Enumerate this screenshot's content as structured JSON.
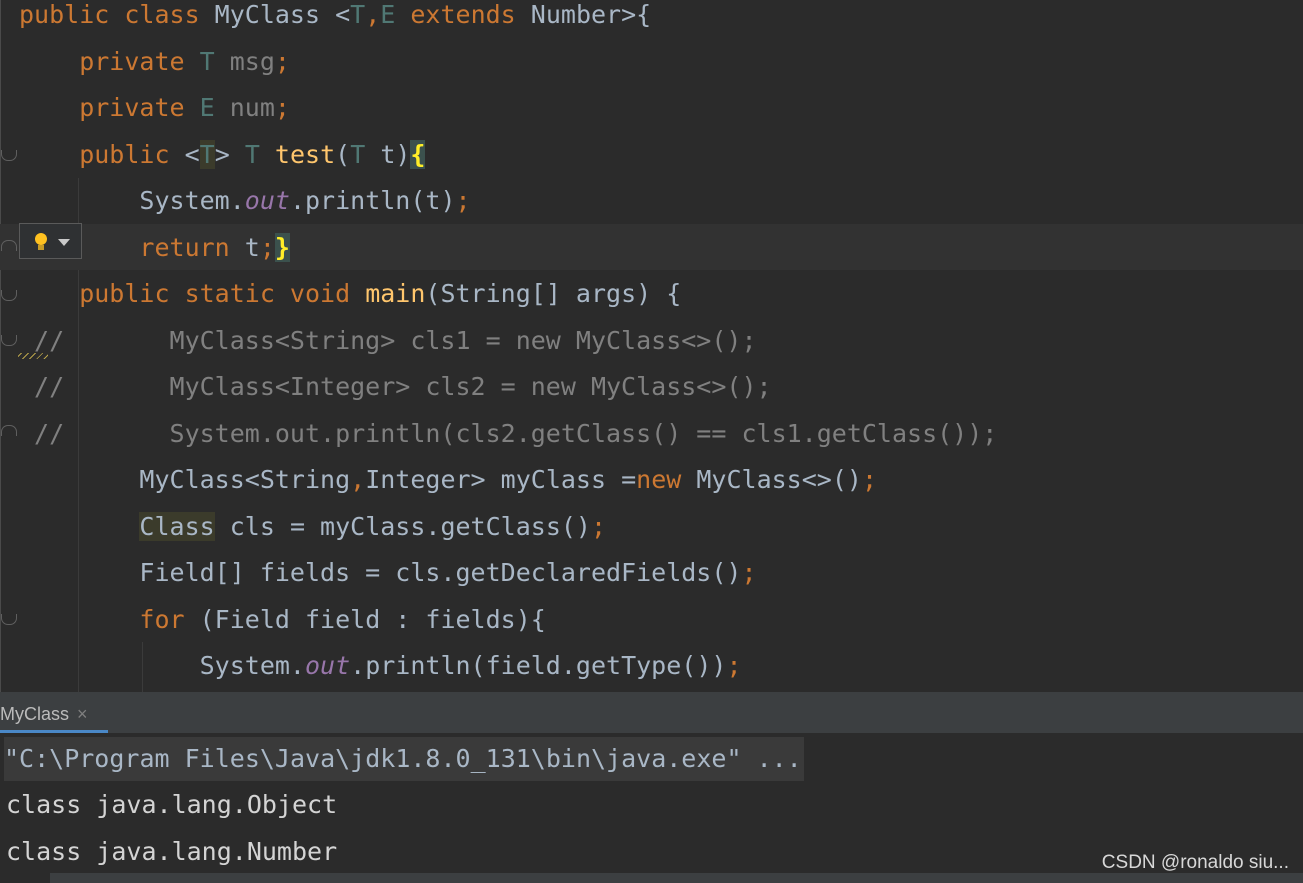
{
  "editor": {
    "lines": [
      {
        "segs": [
          [
            "kw",
            "public class "
          ],
          [
            "",
            "MyClass <"
          ],
          [
            "tp",
            "T"
          ],
          [
            "kw",
            ","
          ],
          [
            "tp",
            "E"
          ],
          [
            "kw",
            " extends "
          ],
          [
            "",
            "Number>{"
          ]
        ]
      },
      {
        "segs": [
          [
            "kw",
            "    private "
          ],
          [
            "tp",
            "T"
          ],
          [
            "cm",
            " msg"
          ],
          [
            "kw",
            ";"
          ]
        ]
      },
      {
        "segs": [
          [
            "kw",
            "    private "
          ],
          [
            "tp",
            "E"
          ],
          [
            "cm",
            " num"
          ],
          [
            "kw",
            ";"
          ]
        ]
      },
      {
        "segs": [
          [
            "kw",
            "    public "
          ],
          [
            "",
            "<"
          ],
          [
            "tp hl-type",
            "T"
          ],
          [
            "",
            "> "
          ],
          [
            "tp",
            "T "
          ],
          [
            "fn",
            "test"
          ],
          [
            "",
            "("
          ],
          [
            "tp",
            "T"
          ],
          [
            "",
            " t)"
          ],
          [
            "hl-brace",
            "{"
          ]
        ]
      },
      {
        "segs": [
          [
            "",
            "        System."
          ],
          [
            "fld",
            "out"
          ],
          [
            "",
            ".println(t)"
          ],
          [
            "kw",
            ";"
          ]
        ]
      },
      {
        "segs": [
          [
            "kw",
            "        return "
          ],
          [
            "",
            "t"
          ],
          [
            "kw",
            ";"
          ],
          [
            "hl-brace",
            "}"
          ]
        ]
      },
      {
        "segs": [
          [
            "kw",
            "    public static void "
          ],
          [
            "fn",
            "main"
          ],
          [
            "",
            "(String[] args) {"
          ]
        ]
      },
      {
        "segs": [
          [
            "cm",
            " //       MyClass<String> cls1 = new MyClass<>();"
          ]
        ]
      },
      {
        "segs": [
          [
            "cm",
            " //       MyClass<Integer> cls2 = new MyClass<>();"
          ]
        ]
      },
      {
        "segs": [
          [
            "cm",
            " //       System.out.println(cls2.getClass() == cls1.getClass());"
          ]
        ]
      },
      {
        "segs": [
          [
            "",
            "        MyClass<String"
          ],
          [
            "kw",
            ","
          ],
          [
            "",
            "Integer> myClass ="
          ],
          [
            "kw",
            "new "
          ],
          [
            "",
            "MyClass<>()"
          ],
          [
            "kw",
            ";"
          ]
        ]
      },
      {
        "segs": [
          [
            "",
            "        "
          ],
          [
            "hl-type",
            "Class"
          ],
          [
            "",
            " cls = myClass.getClass()"
          ],
          [
            "kw",
            ";"
          ]
        ]
      },
      {
        "segs": [
          [
            "",
            "        Field[] fields = cls.getDeclaredFields()"
          ],
          [
            "kw",
            ";"
          ]
        ]
      },
      {
        "segs": [
          [
            "kw",
            "        for "
          ],
          [
            "",
            "(Field field : fields){"
          ]
        ]
      },
      {
        "segs": [
          [
            "",
            "            System."
          ],
          [
            "fld",
            "out"
          ],
          [
            "",
            ".println(field.getType())"
          ],
          [
            "kw",
            ";"
          ]
        ]
      }
    ]
  },
  "run_panel": {
    "tab_label": "MyClass",
    "tab_close": "×",
    "command": "\"C:\\Program Files\\Java\\jdk1.8.0_131\\bin\\java.exe\" ...",
    "output": [
      "class java.lang.Object",
      "class java.lang.Number"
    ]
  },
  "watermark": "CSDN @ronaldo siu...",
  "colors": {
    "keyword": "#cc7832",
    "type_param": "#507874",
    "field": "#9876aa",
    "method": "#ffc66d",
    "comment": "#808080",
    "text": "#a9b7c6"
  },
  "icons": {
    "intention": "lightbulb-icon",
    "fold": "fold-marker-icon"
  }
}
